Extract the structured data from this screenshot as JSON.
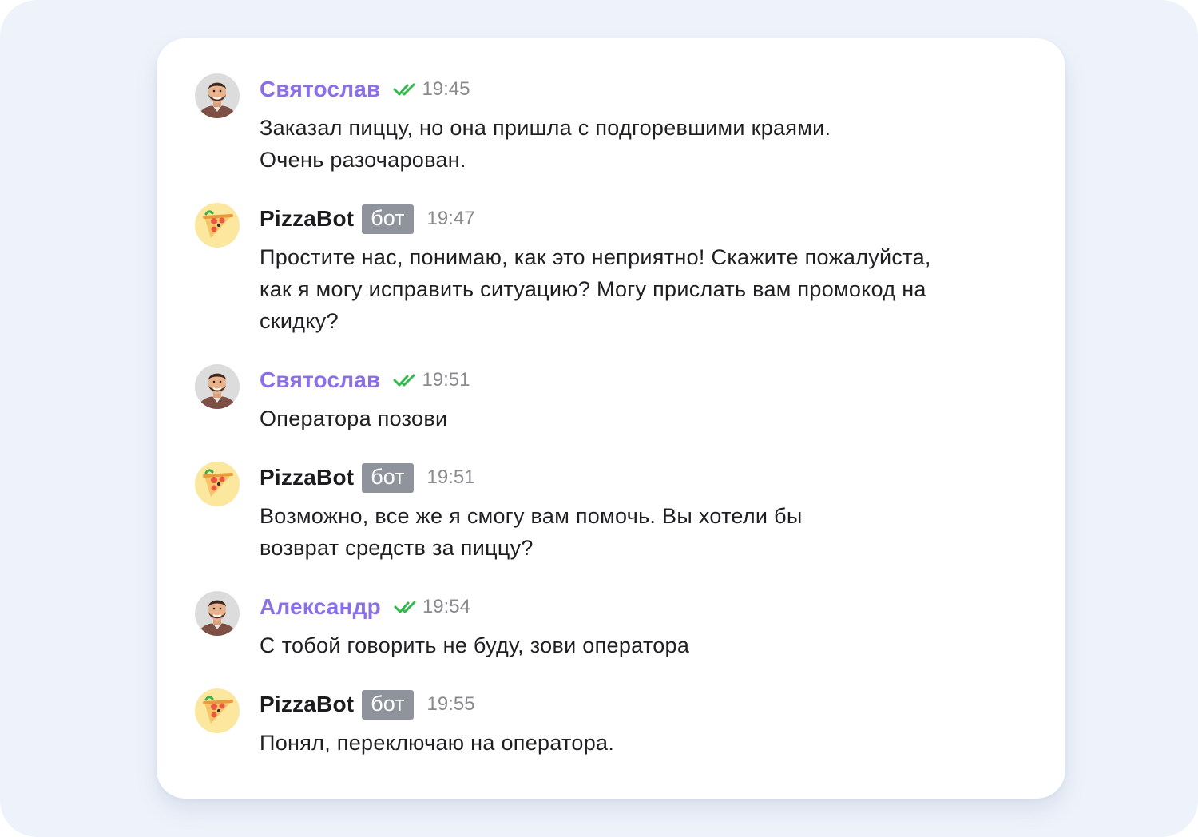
{
  "chat": {
    "bot_badge": "бот",
    "messages": [
      {
        "author": "Святослав",
        "type": "user",
        "time": "19:45",
        "text": "Заказал пиццу, но она пришла с подгоревшими краями.\nОчень разочарован."
      },
      {
        "author": "PizzaBot",
        "type": "bot",
        "time": "19:47",
        "text": "Простите нас, понимаю, как это неприятно! Скажите пожалуйста,\nкак я могу исправить ситуацию? Могу прислать вам промокод на\nскидку?"
      },
      {
        "author": "Святослав",
        "type": "user",
        "time": "19:51",
        "text": "Оператора позови"
      },
      {
        "author": "PizzaBot",
        "type": "bot",
        "time": "19:51",
        "text": "Возможно, все же я смогу вам помочь. Вы хотели бы\nвозврат средств за пиццу?"
      },
      {
        "author": "Александр",
        "type": "user",
        "time": "19:54",
        "text": "С тобой говорить не буду, зови оператора"
      },
      {
        "author": "PizzaBot",
        "type": "bot",
        "time": "19:55",
        "text": "Понял, переключаю на оператора."
      }
    ]
  },
  "icons": {
    "user_avatar": "person-photo-avatar",
    "bot_avatar": "pizza-slice-avatar",
    "read_status": "double-check-icon"
  },
  "colors": {
    "page_background": "#eef3fb",
    "card_background": "#ffffff",
    "user_name": "#8b6fe6",
    "bot_name": "#1c1c1e",
    "bot_badge_bg": "#8f949c",
    "read_check": "#35b84e",
    "timestamp": "#8a8a8f",
    "message_text": "#1f1f22",
    "bot_avatar_bg": "#fbe79e"
  }
}
